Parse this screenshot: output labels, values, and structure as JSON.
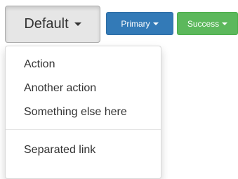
{
  "buttons": {
    "default_label": "Default",
    "primary_label": "Primary",
    "success_label": "Success"
  },
  "dropdown": {
    "items": [
      "Action",
      "Another action",
      "Something else here"
    ],
    "separated_item": "Separated link"
  },
  "colors": {
    "primary": "#337ab7",
    "success": "#5cb85c",
    "default_active": "#e6e6e6"
  }
}
